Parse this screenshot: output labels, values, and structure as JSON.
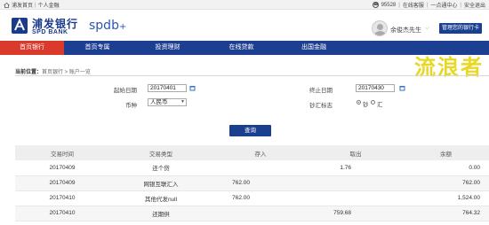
{
  "topbar": {
    "home": "浦发首页",
    "personal": "个人金融",
    "phone": "95528",
    "links": [
      "在线客服",
      "一点通中心",
      "安全退出"
    ]
  },
  "brand": {
    "name_cn": "浦发银行",
    "name_en": "SPD BANK",
    "sub_brand": "spdb",
    "sub_brand_plus": "+"
  },
  "user": {
    "name": "余俊杰先生",
    "manage_label": "管理您的银行卡"
  },
  "nav": {
    "items": [
      "首页银行",
      "首页专属",
      "投资理财",
      "在线贷款",
      "出国金融"
    ],
    "active_index": 0
  },
  "watermark": "流浪者",
  "breadcrumb": {
    "label": "当前位置：",
    "path": "首页银行 > 账户一览"
  },
  "form": {
    "start_label": "起始日期",
    "start_value": "20170401",
    "end_label": "终止日期",
    "end_value": "20170430",
    "currency_label": "币种",
    "currency_value": "人民币",
    "cash_label": "钞汇标志",
    "cash_options": [
      "钞",
      "汇"
    ],
    "cash_selected": "钞",
    "query_label": "查询"
  },
  "table": {
    "headers": [
      "交易时间",
      "交易类型",
      "存入",
      "取出",
      "余额"
    ],
    "rows": [
      [
        "20170409",
        "还个贷",
        "",
        "1.76",
        "0.00"
      ],
      [
        "20170409",
        "网银互联汇入",
        "762.00",
        "",
        "762.00"
      ],
      [
        "20170410",
        "其他代发null",
        "762.00",
        "",
        "1,524.00"
      ],
      [
        "20170410",
        "还期供",
        "",
        "759.68",
        "764.32"
      ]
    ]
  },
  "colors": {
    "nav": "#1d3f92",
    "nav_active": "#d93a2b",
    "button": "#1a3f8f",
    "watermark": "#e4d200"
  }
}
